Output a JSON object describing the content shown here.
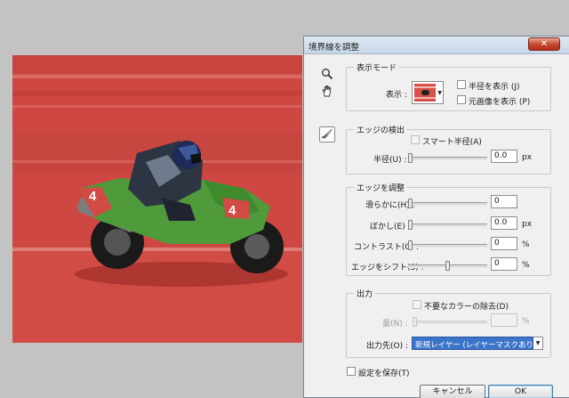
{
  "dialog": {
    "title": "境界線を調整",
    "close_glyph": "✕",
    "view_mode": {
      "legend": "表示モード",
      "view_label": "表示 :",
      "show_radius": "半径を表示 (J)",
      "show_original": "元画像を表示 (P)"
    },
    "edge_detection": {
      "legend": "エッジの検出",
      "smart_radius": "スマート半径(A)",
      "radius_label": "半径(U) :",
      "radius_value": "0.0",
      "radius_unit": "px",
      "radius_level": 0
    },
    "adjust_edge": {
      "legend": "エッジを調整",
      "smooth_label": "滑らかに(H) :",
      "smooth_value": "0",
      "smooth_level": 0,
      "feather_label": "ぼかし(E) :",
      "feather_value": "0.0",
      "feather_unit": "px",
      "feather_level": 0,
      "contrast_label": "コントラスト(C) :",
      "contrast_value": "0",
      "contrast_unit": "%",
      "contrast_level": 0,
      "shift_label": "エッジをシフト(S) :",
      "shift_value": "0",
      "shift_unit": "%",
      "shift_level": 0.5
    },
    "output": {
      "legend": "出力",
      "decontaminate": "不要なカラーの除去(D)",
      "amount_label": "量(N) :",
      "amount_unit": "%",
      "output_to_label": "出力先(O) :",
      "output_to_value": "新規レイヤー (レイヤーマスクあり)"
    },
    "remember_settings": "設定を保存(T)",
    "cancel_label": "キャンセル",
    "ok_label": "OK"
  },
  "tools": {
    "zoom": "zoom-icon",
    "hand": "hand-icon",
    "refine_radius": "refine-radius-brush-icon"
  },
  "canvas": {
    "subject": "motorcycle racer on track with red overlay",
    "number_plate": "4"
  },
  "colors": {
    "overlay_red": "#d04a44",
    "selection_blue": "#3b74c9",
    "bike_green": "#4f9a3a"
  }
}
